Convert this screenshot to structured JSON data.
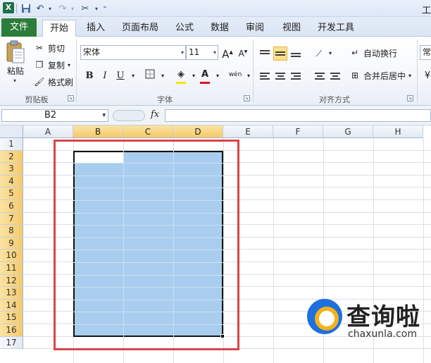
{
  "window": {
    "title_fragment": "工"
  },
  "tabs": [
    "文件",
    "开始",
    "插入",
    "页面布局",
    "公式",
    "数据",
    "审阅",
    "视图",
    "开发工具"
  ],
  "active_tab": "开始",
  "clipboard": {
    "paste_label": "粘贴",
    "cut_label": "剪切",
    "copy_label": "复制",
    "format_painter_label": "格式刷",
    "group_label": "剪贴板"
  },
  "font": {
    "font_name": "宋体",
    "font_size": "11",
    "grow_label": "A",
    "shrink_label": "A",
    "bold_label": "B",
    "italic_label": "I",
    "underline_label": "U",
    "font_color_label": "A",
    "wen_label": "wén",
    "group_label": "字体"
  },
  "alignment": {
    "wrap_text_label": "自动换行",
    "merge_center_label": "合并后居中",
    "group_label": "对齐方式"
  },
  "number": {
    "partial_label": "常"
  },
  "formula_bar": {
    "name_box": "B2",
    "fx_label": "fx",
    "formula": ""
  },
  "grid": {
    "columns": [
      "A",
      "B",
      "C",
      "D",
      "E",
      "F",
      "G",
      "H"
    ],
    "rows": [
      "1",
      "2",
      "3",
      "4",
      "5",
      "6",
      "7",
      "8",
      "9",
      "10",
      "11",
      "12",
      "13",
      "14",
      "15",
      "16",
      "17"
    ],
    "selected_range": "B2:D16",
    "selected_columns": [
      "B",
      "C",
      "D"
    ],
    "selected_rows_from": 2,
    "selected_rows_to": 16
  },
  "colors": {
    "selection_fill": "#a9cdee",
    "header_highlight": "#f5c96a",
    "annotation_box": "#d9454b",
    "file_tab": "#2d7d3a"
  },
  "watermark": {
    "text": "查询啦",
    "url": "chaxunla.com"
  }
}
